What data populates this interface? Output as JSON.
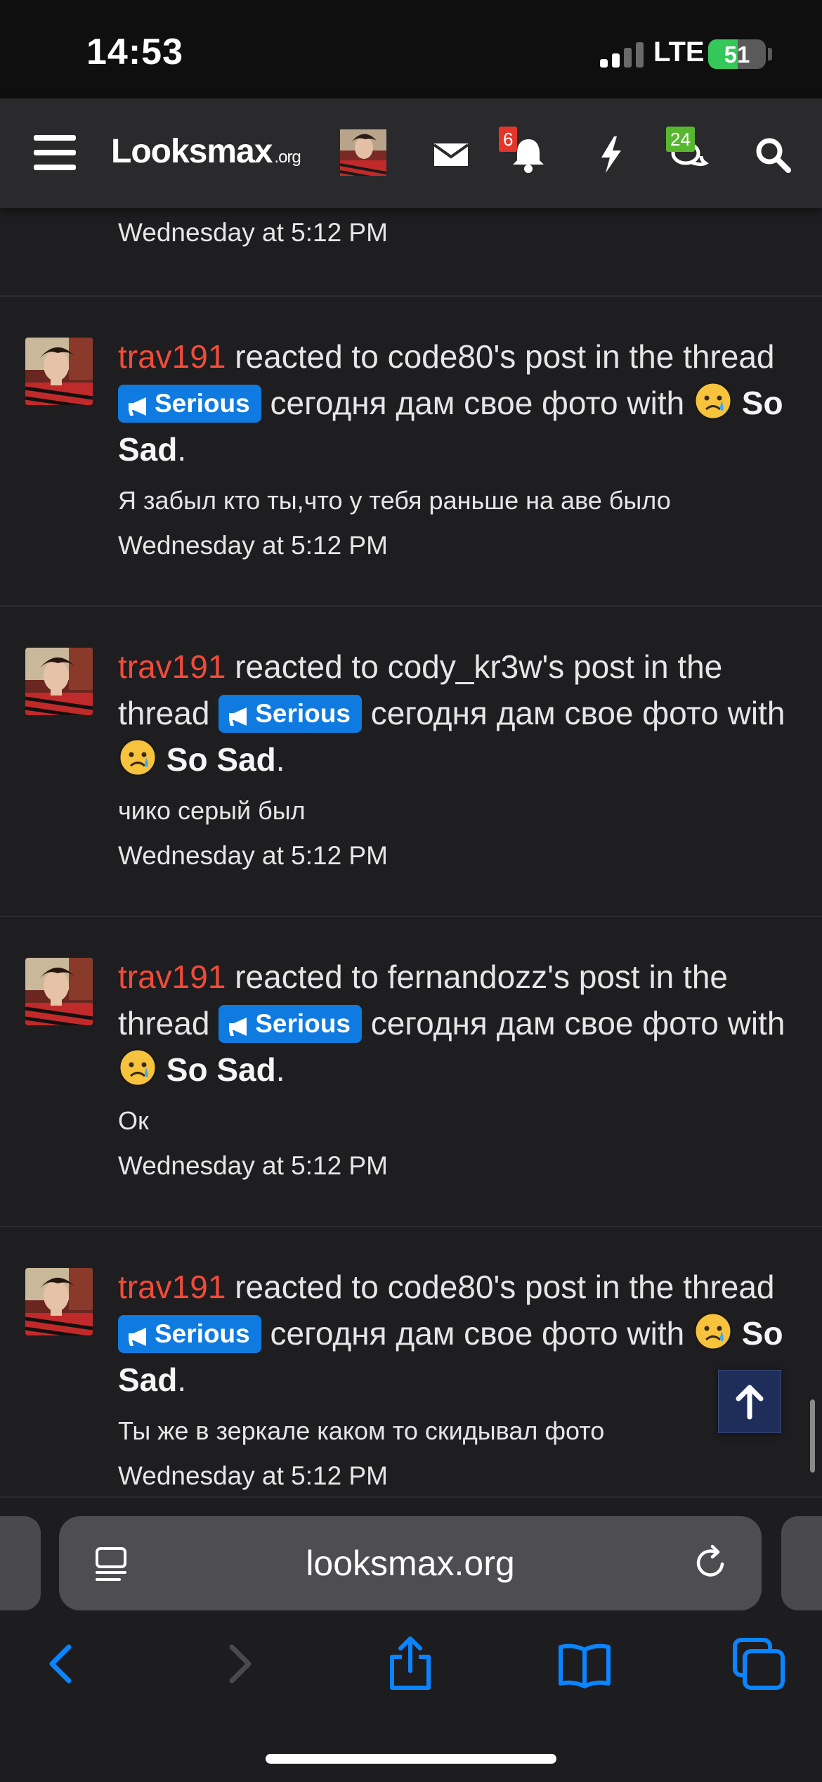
{
  "status_bar": {
    "time": "14:53",
    "network": "LTE",
    "battery": "51",
    "battery_level": 0.51,
    "signal_bars": 2
  },
  "header": {
    "logo_main": "Looksmax",
    "logo_tld": ".org",
    "alerts_badge": "6",
    "conversations_badge": "24",
    "icons": [
      "menu-icon",
      "envelope-icon",
      "bell-icon",
      "bolt-icon",
      "chat-icon",
      "search-icon"
    ]
  },
  "feed": {
    "top_item": {
      "time": "Wednesday at 5:12 PM"
    },
    "alerts": [
      {
        "user": "trav191",
        "text_pre": "reacted to code80's post in the thread",
        "prefix": "Serious",
        "thread_title": "сегодня дам свое фото",
        "with_text": "with",
        "reaction": "So Sad",
        "snippet": "Я забыл кто ты,что у тебя раньше на аве было",
        "time": "Wednesday at 5:12 PM"
      },
      {
        "user": "trav191",
        "text_pre": "reacted to cody_kr3w's post in the thread",
        "prefix": "Serious",
        "thread_title": "сегодня дам свое фото",
        "with_text": "with",
        "reaction": "So Sad",
        "snippet": "чико серый был",
        "time": "Wednesday at 5:12 PM"
      },
      {
        "user": "trav191",
        "text_pre": "reacted to fernandozz's post in the thread",
        "prefix": "Serious",
        "thread_title": "сегодня дам свое фото",
        "with_text": "with",
        "reaction": "So Sad",
        "snippet": "Ок",
        "time": "Wednesday at 5:12 PM"
      },
      {
        "user": "trav191",
        "text_pre": "reacted to code80's post in the thread",
        "prefix": "Serious",
        "thread_title": "сегодня дам свое фото",
        "with_text": "with",
        "reaction": "So Sad",
        "snippet": "Ты же в зеркале каком то скидывал фото",
        "time": "Wednesday at 5:12 PM"
      }
    ]
  },
  "browser": {
    "url": "looksmax.org",
    "toolbar": [
      "back-icon",
      "forward-icon",
      "share-icon",
      "bookmarks-icon",
      "tabs-icon"
    ]
  },
  "colors": {
    "username": "#f24b3a",
    "prefix_bg": "#0f7be0",
    "alerts_badge": "#e5342a",
    "conversations_badge": "#57b82f",
    "browser_accent": "#0a84ff"
  }
}
